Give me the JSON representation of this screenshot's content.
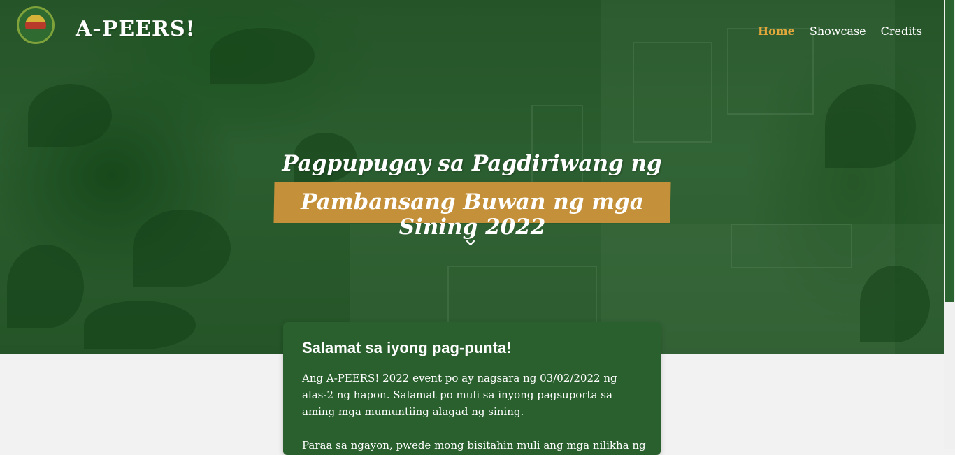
{
  "header": {
    "brand": "A-PEERS!",
    "nav": [
      {
        "label": "Home",
        "active": true
      },
      {
        "label": "Showcase",
        "active": false
      },
      {
        "label": "Credits",
        "active": false
      }
    ]
  },
  "hero": {
    "line1": "Pagpupugay sa Pagdiriwang ng",
    "line2": "Pambansang Buwan ng mga Sining 2022",
    "scroll_icon": "chevron-down-icon"
  },
  "card": {
    "title": "Salamat sa iyong pag-punta!",
    "paragraph1": "Ang A-PEERS! 2022 event po ay nagsara ng 03/02/2022 ng alas-2 ng hapon. Salamat po muli sa inyong pagsuporta sa aming mga mumuntiing alagad ng sining.",
    "paragraph2": "Paraa sa ngayon, pwede mong bisitahin muli ang mga nilikha ng"
  },
  "colors": {
    "accent": "#e2a83c",
    "highlight": "#c4913a",
    "card_bg": "#2a5f2e"
  }
}
